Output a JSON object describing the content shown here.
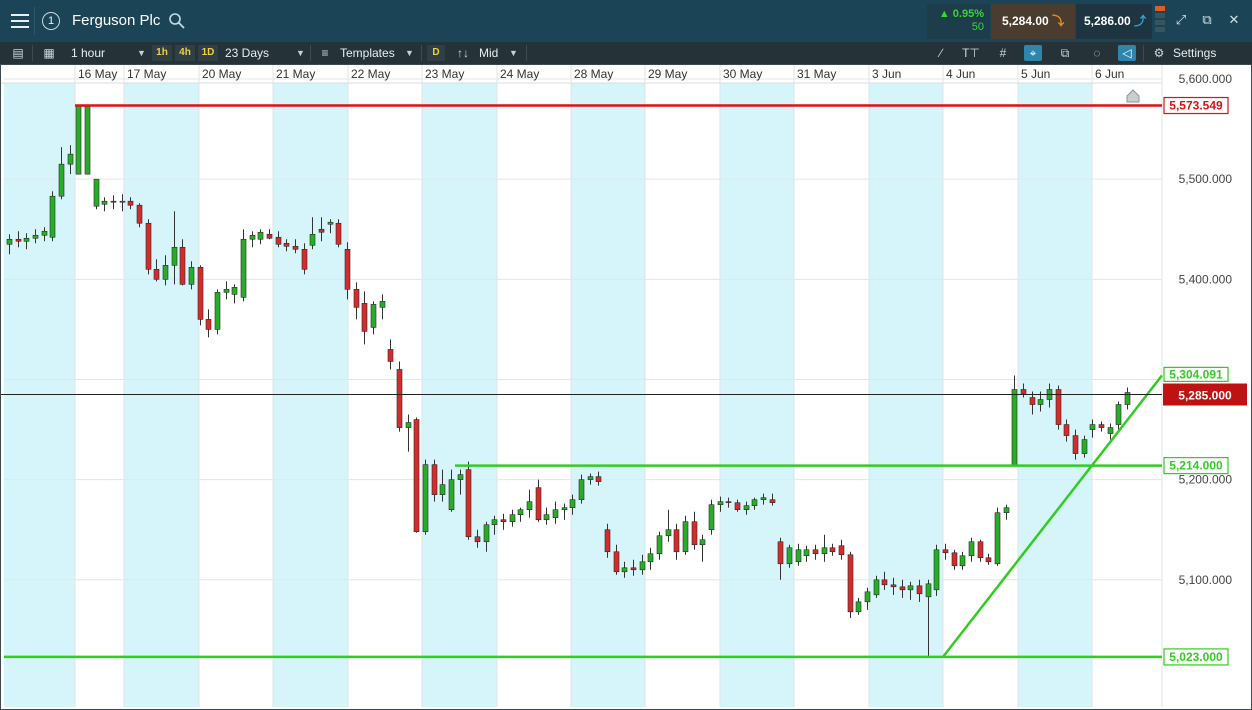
{
  "header": {
    "instrument": "Ferguson Plc",
    "window_number": "1",
    "change_pct": "▲ 0.95%",
    "change_spread": "50",
    "sell_price": "5,284.00",
    "buy_price": "5,286.00"
  },
  "toolbar": {
    "interval": "1 hour",
    "quick_1h": "1h",
    "quick_4h": "4h",
    "quick_1d": "1D",
    "range": "23 Days",
    "templates_label": "Templates",
    "d_button": "D",
    "price_type": "Mid",
    "settings_label": "Settings"
  },
  "colors": {
    "bull": "#27ae27",
    "bear": "#d42c2c",
    "support": "#33cc22",
    "resistance": "#dd1111",
    "day_shade": "#d6f5fa",
    "current_price_bg": "#bf1313"
  },
  "icons": [
    "hamburger-icon",
    "search-icon",
    "down-arrow-icon",
    "up-arrow-icon",
    "expand-icon",
    "popout-icon",
    "close-icon",
    "list-icon",
    "layout-icon",
    "candle-icon",
    "draw-line-icon",
    "text-icon",
    "grid-icon",
    "crosshair-icon",
    "layers-icon",
    "indicator-icon",
    "tag-icon",
    "gear-icon",
    "home-marker-icon"
  ],
  "chart_data": {
    "type": "candlestick",
    "title": "Ferguson Plc",
    "interval": "1 hour",
    "x_axis_labels": [
      "16 May",
      "17 May",
      "20 May",
      "21 May",
      "22 May",
      "23 May",
      "24 May",
      "28 May",
      "29 May",
      "30 May",
      "31 May",
      "3 Jun",
      "4 Jun",
      "5 Jun",
      "6 Jun"
    ],
    "y_axis_ticks": [
      "5,600.000",
      "5,500.000",
      "5,400.000",
      "5,200.000",
      "5,100.000"
    ],
    "ylim": [
      4970,
      5615
    ],
    "current_price": 5285,
    "current_price_label": "5,285.000",
    "grid": true,
    "horizontal_lines": [
      {
        "name": "resistance",
        "value": 5573.549,
        "label": "5,573.549",
        "color": "red"
      },
      {
        "name": "support-upper",
        "value": 5214.0,
        "label": "5,214.000",
        "color": "green"
      },
      {
        "name": "support-lower",
        "value": 5023.0,
        "label": "5,023.000",
        "color": "green"
      }
    ],
    "trendline": {
      "start": {
        "day": "4 Jun",
        "value": 5023
      },
      "end": {
        "day": "6 Jun",
        "value": 5304.091
      },
      "label": "5,304.091"
    },
    "candles": [
      {
        "o": 5435,
        "h": 5445,
        "l": 5425,
        "c": 5440
      },
      {
        "o": 5440,
        "h": 5448,
        "l": 5432,
        "c": 5438
      },
      {
        "o": 5438,
        "h": 5446,
        "l": 5430,
        "c": 5441
      },
      {
        "o": 5441,
        "h": 5450,
        "l": 5436,
        "c": 5444
      },
      {
        "o": 5444,
        "h": 5452,
        "l": 5438,
        "c": 5448
      },
      {
        "o": 5442,
        "h": 5488,
        "l": 5438,
        "c": 5483
      },
      {
        "o": 5483,
        "h": 5532,
        "l": 5480,
        "c": 5515
      },
      {
        "o": 5515,
        "h": 5534,
        "l": 5505,
        "c": 5525
      },
      {
        "o": 5505,
        "h": 5573,
        "l": 5505,
        "c": 5573
      },
      {
        "o": 5505,
        "h": 5573,
        "l": 5505,
        "c": 5573
      },
      {
        "o": 5473,
        "h": 5490,
        "l": 5470,
        "c": 5500
      },
      {
        "o": 5475,
        "h": 5482,
        "l": 5468,
        "c": 5478
      },
      {
        "o": 5478,
        "h": 5484,
        "l": 5470,
        "c": 5477
      },
      {
        "o": 5477,
        "h": 5485,
        "l": 5468,
        "c": 5478
      },
      {
        "o": 5478,
        "h": 5482,
        "l": 5470,
        "c": 5474
      },
      {
        "o": 5474,
        "h": 5476,
        "l": 5452,
        "c": 5456
      },
      {
        "o": 5456,
        "h": 5460,
        "l": 5405,
        "c": 5410
      },
      {
        "o": 5410,
        "h": 5420,
        "l": 5398,
        "c": 5400
      },
      {
        "o": 5400,
        "h": 5424,
        "l": 5394,
        "c": 5414
      },
      {
        "o": 5414,
        "h": 5468,
        "l": 5395,
        "c": 5432
      },
      {
        "o": 5432,
        "h": 5440,
        "l": 5394,
        "c": 5395
      },
      {
        "o": 5395,
        "h": 5418,
        "l": 5390,
        "c": 5412
      },
      {
        "o": 5412,
        "h": 5414,
        "l": 5354,
        "c": 5360
      },
      {
        "o": 5360,
        "h": 5370,
        "l": 5342,
        "c": 5350
      },
      {
        "o": 5350,
        "h": 5390,
        "l": 5345,
        "c": 5387
      },
      {
        "o": 5387,
        "h": 5398,
        "l": 5380,
        "c": 5390
      },
      {
        "o": 5385,
        "h": 5395,
        "l": 5376,
        "c": 5392
      },
      {
        "o": 5382,
        "h": 5450,
        "l": 5378,
        "c": 5440
      },
      {
        "o": 5440,
        "h": 5448,
        "l": 5432,
        "c": 5444
      },
      {
        "o": 5440,
        "h": 5450,
        "l": 5435,
        "c": 5447
      },
      {
        "o": 5445,
        "h": 5450,
        "l": 5440,
        "c": 5441
      },
      {
        "o": 5442,
        "h": 5448,
        "l": 5432,
        "c": 5435
      },
      {
        "o": 5436,
        "h": 5440,
        "l": 5428,
        "c": 5433
      },
      {
        "o": 5433,
        "h": 5440,
        "l": 5426,
        "c": 5430
      },
      {
        "o": 5430,
        "h": 5436,
        "l": 5405,
        "c": 5410
      },
      {
        "o": 5434,
        "h": 5462,
        "l": 5430,
        "c": 5445
      },
      {
        "o": 5450,
        "h": 5462,
        "l": 5438,
        "c": 5447
      },
      {
        "o": 5455,
        "h": 5460,
        "l": 5446,
        "c": 5457
      },
      {
        "o": 5456,
        "h": 5460,
        "l": 5432,
        "c": 5435
      },
      {
        "o": 5430,
        "h": 5437,
        "l": 5380,
        "c": 5390
      },
      {
        "o": 5390,
        "h": 5397,
        "l": 5360,
        "c": 5372
      },
      {
        "o": 5376,
        "h": 5388,
        "l": 5335,
        "c": 5348
      },
      {
        "o": 5352,
        "h": 5378,
        "l": 5345,
        "c": 5375
      },
      {
        "o": 5372,
        "h": 5385,
        "l": 5360,
        "c": 5378
      },
      {
        "o": 5330,
        "h": 5340,
        "l": 5310,
        "c": 5318
      },
      {
        "o": 5310,
        "h": 5318,
        "l": 5248,
        "c": 5252
      },
      {
        "o": 5252,
        "h": 5265,
        "l": 5228,
        "c": 5257
      },
      {
        "o": 5260,
        "h": 5262,
        "l": 5147,
        "c": 5148
      },
      {
        "o": 5148,
        "h": 5220,
        "l": 5145,
        "c": 5215
      },
      {
        "o": 5215,
        "h": 5220,
        "l": 5178,
        "c": 5185
      },
      {
        "o": 5185,
        "h": 5210,
        "l": 5178,
        "c": 5195
      },
      {
        "o": 5170,
        "h": 5210,
        "l": 5168,
        "c": 5200
      },
      {
        "o": 5200,
        "h": 5210,
        "l": 5185,
        "c": 5205
      },
      {
        "o": 5210,
        "h": 5218,
        "l": 5140,
        "c": 5143
      },
      {
        "o": 5143,
        "h": 5150,
        "l": 5132,
        "c": 5138
      },
      {
        "o": 5138,
        "h": 5158,
        "l": 5128,
        "c": 5155
      },
      {
        "o": 5155,
        "h": 5164,
        "l": 5145,
        "c": 5160
      },
      {
        "o": 5160,
        "h": 5166,
        "l": 5150,
        "c": 5158
      },
      {
        "o": 5158,
        "h": 5170,
        "l": 5153,
        "c": 5165
      },
      {
        "o": 5165,
        "h": 5172,
        "l": 5158,
        "c": 5170
      },
      {
        "o": 5170,
        "h": 5190,
        "l": 5162,
        "c": 5178
      },
      {
        "o": 5192,
        "h": 5200,
        "l": 5158,
        "c": 5160
      },
      {
        "o": 5160,
        "h": 5172,
        "l": 5155,
        "c": 5165
      },
      {
        "o": 5162,
        "h": 5178,
        "l": 5156,
        "c": 5170
      },
      {
        "o": 5170,
        "h": 5176,
        "l": 5160,
        "c": 5172
      },
      {
        "o": 5172,
        "h": 5185,
        "l": 5165,
        "c": 5180
      },
      {
        "o": 5180,
        "h": 5205,
        "l": 5176,
        "c": 5200
      },
      {
        "o": 5200,
        "h": 5206,
        "l": 5195,
        "c": 5203
      },
      {
        "o": 5203,
        "h": 5208,
        "l": 5194,
        "c": 5198
      },
      {
        "o": 5150,
        "h": 5156,
        "l": 5122,
        "c": 5128
      },
      {
        "o": 5128,
        "h": 5135,
        "l": 5105,
        "c": 5108
      },
      {
        "o": 5108,
        "h": 5118,
        "l": 5102,
        "c": 5112
      },
      {
        "o": 5112,
        "h": 5120,
        "l": 5104,
        "c": 5110
      },
      {
        "o": 5110,
        "h": 5125,
        "l": 5105,
        "c": 5118
      },
      {
        "o": 5118,
        "h": 5132,
        "l": 5110,
        "c": 5126
      },
      {
        "o": 5126,
        "h": 5148,
        "l": 5120,
        "c": 5144
      },
      {
        "o": 5144,
        "h": 5170,
        "l": 5138,
        "c": 5150
      },
      {
        "o": 5150,
        "h": 5156,
        "l": 5120,
        "c": 5128
      },
      {
        "o": 5128,
        "h": 5164,
        "l": 5125,
        "c": 5158
      },
      {
        "o": 5158,
        "h": 5168,
        "l": 5130,
        "c": 5135
      },
      {
        "o": 5135,
        "h": 5145,
        "l": 5118,
        "c": 5140
      },
      {
        "o": 5150,
        "h": 5180,
        "l": 5145,
        "c": 5175
      },
      {
        "o": 5175,
        "h": 5183,
        "l": 5168,
        "c": 5178
      },
      {
        "o": 5178,
        "h": 5182,
        "l": 5172,
        "c": 5177
      },
      {
        "o": 5177,
        "h": 5180,
        "l": 5168,
        "c": 5170
      },
      {
        "o": 5170,
        "h": 5178,
        "l": 5165,
        "c": 5174
      },
      {
        "o": 5174,
        "h": 5182,
        "l": 5170,
        "c": 5180
      },
      {
        "o": 5180,
        "h": 5186,
        "l": 5175,
        "c": 5182
      },
      {
        "o": 5180,
        "h": 5186,
        "l": 5174,
        "c": 5177
      },
      {
        "o": 5138,
        "h": 5142,
        "l": 5100,
        "c": 5116
      },
      {
        "o": 5116,
        "h": 5135,
        "l": 5112,
        "c": 5132
      },
      {
        "o": 5118,
        "h": 5136,
        "l": 5114,
        "c": 5130
      },
      {
        "o": 5124,
        "h": 5134,
        "l": 5118,
        "c": 5130
      },
      {
        "o": 5130,
        "h": 5135,
        "l": 5120,
        "c": 5126
      },
      {
        "o": 5126,
        "h": 5145,
        "l": 5118,
        "c": 5132
      },
      {
        "o": 5132,
        "h": 5136,
        "l": 5124,
        "c": 5128
      },
      {
        "o": 5134,
        "h": 5140,
        "l": 5120,
        "c": 5125
      },
      {
        "o": 5125,
        "h": 5128,
        "l": 5062,
        "c": 5068
      },
      {
        "o": 5068,
        "h": 5082,
        "l": 5065,
        "c": 5078
      },
      {
        "o": 5078,
        "h": 5092,
        "l": 5070,
        "c": 5088
      },
      {
        "o": 5085,
        "h": 5104,
        "l": 5082,
        "c": 5100
      },
      {
        "o": 5100,
        "h": 5108,
        "l": 5090,
        "c": 5095
      },
      {
        "o": 5095,
        "h": 5102,
        "l": 5085,
        "c": 5093
      },
      {
        "o": 5093,
        "h": 5100,
        "l": 5082,
        "c": 5090
      },
      {
        "o": 5090,
        "h": 5098,
        "l": 5080,
        "c": 5094
      },
      {
        "o": 5094,
        "h": 5100,
        "l": 5078,
        "c": 5086
      },
      {
        "o": 5083,
        "h": 5100,
        "l": 5023,
        "c": 5096
      },
      {
        "o": 5090,
        "h": 5135,
        "l": 5084,
        "c": 5130
      },
      {
        "o": 5130,
        "h": 5136,
        "l": 5120,
        "c": 5127
      },
      {
        "o": 5127,
        "h": 5130,
        "l": 5110,
        "c": 5114
      },
      {
        "o": 5114,
        "h": 5128,
        "l": 5110,
        "c": 5124
      },
      {
        "o": 5124,
        "h": 5142,
        "l": 5118,
        "c": 5138
      },
      {
        "o": 5138,
        "h": 5140,
        "l": 5118,
        "c": 5122
      },
      {
        "o": 5122,
        "h": 5126,
        "l": 5115,
        "c": 5118
      },
      {
        "o": 5116,
        "h": 5172,
        "l": 5114,
        "c": 5167
      },
      {
        "o": 5167,
        "h": 5175,
        "l": 5160,
        "c": 5172
      },
      {
        "o": 5214,
        "h": 5304,
        "l": 5214,
        "c": 5290
      },
      {
        "o": 5290,
        "h": 5296,
        "l": 5282,
        "c": 5286
      },
      {
        "o": 5282,
        "h": 5288,
        "l": 5265,
        "c": 5275
      },
      {
        "o": 5275,
        "h": 5288,
        "l": 5268,
        "c": 5280
      },
      {
        "o": 5280,
        "h": 5296,
        "l": 5272,
        "c": 5290
      },
      {
        "o": 5290,
        "h": 5294,
        "l": 5250,
        "c": 5255
      },
      {
        "o": 5255,
        "h": 5260,
        "l": 5238,
        "c": 5244
      },
      {
        "o": 5244,
        "h": 5250,
        "l": 5220,
        "c": 5226
      },
      {
        "o": 5226,
        "h": 5244,
        "l": 5222,
        "c": 5240
      },
      {
        "o": 5250,
        "h": 5260,
        "l": 5242,
        "c": 5255
      },
      {
        "o": 5255,
        "h": 5258,
        "l": 5248,
        "c": 5252
      },
      {
        "o": 5246,
        "h": 5256,
        "l": 5240,
        "c": 5252
      },
      {
        "o": 5255,
        "h": 5278,
        "l": 5250,
        "c": 5275
      },
      {
        "o": 5275,
        "h": 5292,
        "l": 5270,
        "c": 5287
      }
    ]
  }
}
